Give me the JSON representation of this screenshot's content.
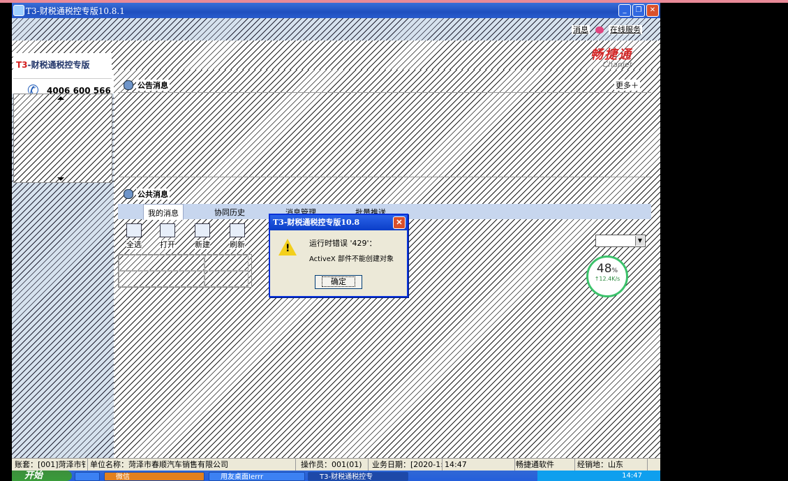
{
  "window": {
    "title": "T3-财税通税控专版10.8.1",
    "controls": {
      "minimize": "_",
      "maximize": "❐",
      "close": "✕"
    }
  },
  "nav": {
    "message_link": "消息",
    "online_service_link": "在线服务"
  },
  "brand": {
    "product_prefix": "T3",
    "product_rest": "-财税通税控专版",
    "phone_number": "4006 600 566",
    "logo_cn": "畅捷通",
    "logo_en": "Chanjet"
  },
  "notice": {
    "title": "公告消息",
    "more": "更多＋"
  },
  "public": {
    "title": "公共消息",
    "tabs": [
      {
        "label": "我的消息"
      },
      {
        "label": "协同历史"
      },
      {
        "label": "消息管理"
      },
      {
        "label": "批量推送"
      }
    ],
    "toolbar": [
      {
        "label": "全选",
        "icon": "select-all-icon"
      },
      {
        "label": "打开",
        "icon": "open-icon"
      },
      {
        "label": "新建",
        "icon": "new-icon"
      },
      {
        "label": "刷新",
        "icon": "refresh-icon"
      }
    ]
  },
  "net_gauge": {
    "percent": "48",
    "percent_unit": "%",
    "speed": "↑12.4K/s"
  },
  "dialog": {
    "title": "T3-财税通税控专版10.8",
    "close": "✕",
    "message_line1": "运行时错误 '429'：",
    "message_line2": "ActiveX 部件不能创建对象",
    "ok_button": "确定",
    "icon": "warning-icon"
  },
  "status_bar": {
    "account": "账套：[001]菏泽市钅",
    "company": "单位名称：菏泽市春顺汽车销售有限公司",
    "operator": "操作员：001(01)",
    "business_date": "业务日期：[2020-1:",
    "time": "14:47",
    "vendor": "畅捷通软件",
    "distributor": "经销地：山东"
  },
  "taskbar": {
    "start": "开始",
    "tasks": [
      {
        "label": "微信"
      },
      {
        "label": "用友桌面Ierrr"
      },
      {
        "label": "T3-财税通税控专"
      }
    ],
    "clock": "14:47"
  }
}
